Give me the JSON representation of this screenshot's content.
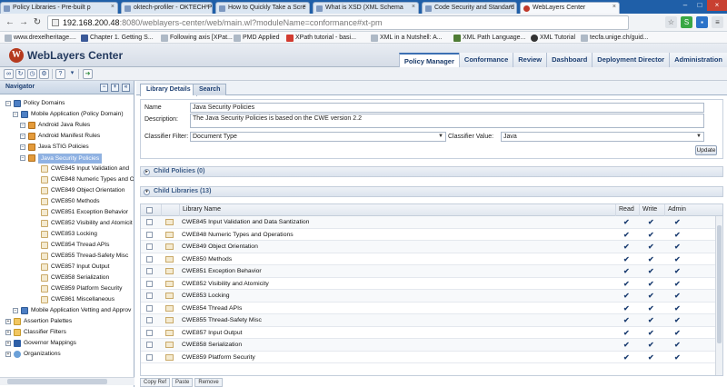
{
  "browser": {
    "tabs": [
      {
        "label": "Policy Libraries - Pre-built p",
        "active": false
      },
      {
        "label": "oktech-profiler - OKTECH P",
        "active": false
      },
      {
        "label": "How to Quickly Take a Scre",
        "active": false
      },
      {
        "label": "What is XSD (XML Schema",
        "active": false
      },
      {
        "label": "Code Security and Standard",
        "active": false
      },
      {
        "label": "WebLayers Center",
        "active": true
      }
    ],
    "url_host": "192.168.200.48",
    "url_path": ":8080/weblayers-center/web/main.wl?moduleName=conformance#xt-pm",
    "bookmarks": [
      "www.drexelheritage....",
      "Chapter 1. Getting S...",
      "Following axis [XPat...",
      "PMD Applied",
      "XPath tutorial - basi...",
      "XML in a Nutshell: A...",
      "XML Path Language...",
      "XML Tutorial",
      "tecfa.unige.ch/guid..."
    ]
  },
  "app": {
    "logo_letter": "W",
    "title": "WebLayers Center",
    "nav": [
      "Policy Manager",
      "Conformance",
      "Review",
      "Dashboard",
      "Deployment Director",
      "Administration"
    ],
    "active_nav": "Policy Manager"
  },
  "navigator": {
    "title": "Navigator",
    "tree": [
      {
        "label": "Policy Domains",
        "level": 0,
        "icon": "domain"
      },
      {
        "label": "Mobile Application (Policy Domain)",
        "level": 1,
        "icon": "domain"
      },
      {
        "label": "Android Java Rules",
        "level": 2,
        "icon": "policy"
      },
      {
        "label": "Android Manifest Rules",
        "level": 2,
        "icon": "policy"
      },
      {
        "label": "Java STIG Policies",
        "level": 2,
        "icon": "policy"
      },
      {
        "label": "Java Security Policies",
        "level": 2,
        "icon": "policy",
        "selected": true
      },
      {
        "label": "CWE845 Input Validation and",
        "level": 3,
        "icon": "lib"
      },
      {
        "label": "CWE848 Numeric Types and O",
        "level": 3,
        "icon": "lib"
      },
      {
        "label": "CWE849 Object Orientation",
        "level": 3,
        "icon": "lib"
      },
      {
        "label": "CWE850 Methods",
        "level": 3,
        "icon": "lib"
      },
      {
        "label": "CWE851 Exception Behavior",
        "level": 3,
        "icon": "lib"
      },
      {
        "label": "CWE852 Visibility and Atomicit",
        "level": 3,
        "icon": "lib"
      },
      {
        "label": "CWE853 Locking",
        "level": 3,
        "icon": "lib"
      },
      {
        "label": "CWE854 Thread APIs",
        "level": 3,
        "icon": "lib"
      },
      {
        "label": "CWE855 Thread-Safety Misc",
        "level": 3,
        "icon": "lib"
      },
      {
        "label": "CWE857 Input Output",
        "level": 3,
        "icon": "lib"
      },
      {
        "label": "CWE858 Serialization",
        "level": 3,
        "icon": "lib"
      },
      {
        "label": "CWE859 Platform Security",
        "level": 3,
        "icon": "lib"
      },
      {
        "label": "CWE861 Miscellaneous",
        "level": 3,
        "icon": "lib"
      },
      {
        "label": "Mobile Application Vetting and Approv",
        "level": 1,
        "icon": "domain"
      },
      {
        "label": "Assertion Palettes",
        "level": 0,
        "icon": "folder"
      },
      {
        "label": "Classifier Filters",
        "level": 0,
        "icon": "folder"
      },
      {
        "label": "Governor Mappings",
        "level": 0,
        "icon": "blue"
      },
      {
        "label": "Organizations",
        "level": 0,
        "icon": "org"
      }
    ]
  },
  "content": {
    "tabs": [
      "Library Details",
      "Search"
    ],
    "active_tab": "Library Details",
    "details": {
      "name_label": "Name",
      "name_value": "Java Security Policies",
      "desc_label": "Description:",
      "desc_value": "The Java Security Policies is based on the CWE version 2.2",
      "filter_label": "Classifier Filter:",
      "filter_value": "Document Type",
      "value_label": "Classifier Value:",
      "value_value": "Java",
      "update_label": "Update"
    },
    "child_policies_label": "Child Policies (0)",
    "child_libraries_label": "Child Libraries (13)",
    "table": {
      "headers": [
        "Library Name",
        "Read",
        "Write",
        "Admin"
      ],
      "rows": [
        "CWE845 Input Validation and Data Santization",
        "CWE848 Numeric Types and Operations",
        "CWE849 Object Orientation",
        "CWE850 Methods",
        "CWE851 Exception Behavior",
        "CWE852 Visibility and Atomicity",
        "CWE853 Locking",
        "CWE854 Thread APIs",
        "CWE855 Thread-Safety Misc",
        "CWE857 Input Output",
        "CWE858 Serialization",
        "CWE859 Platform Security"
      ],
      "check_glyph": "✔"
    },
    "bottom_buttons": [
      "Copy Ref",
      "Paste",
      "Remove"
    ]
  }
}
